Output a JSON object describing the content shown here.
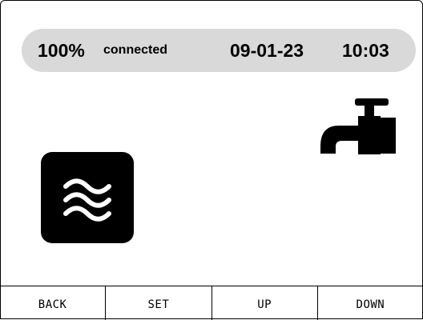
{
  "status": {
    "battery": "100%",
    "connection": "connected",
    "date": "09-01-23",
    "time": "10:03"
  },
  "icons": {
    "tap": "water-tap-icon",
    "waves": "water-waves-icon"
  },
  "softkeys": [
    "BACK",
    "SET",
    "UP",
    "DOWN"
  ],
  "colors": {
    "status_bar_bg": "#d9d9d9",
    "foreground": "#000000",
    "background": "#ffffff"
  }
}
